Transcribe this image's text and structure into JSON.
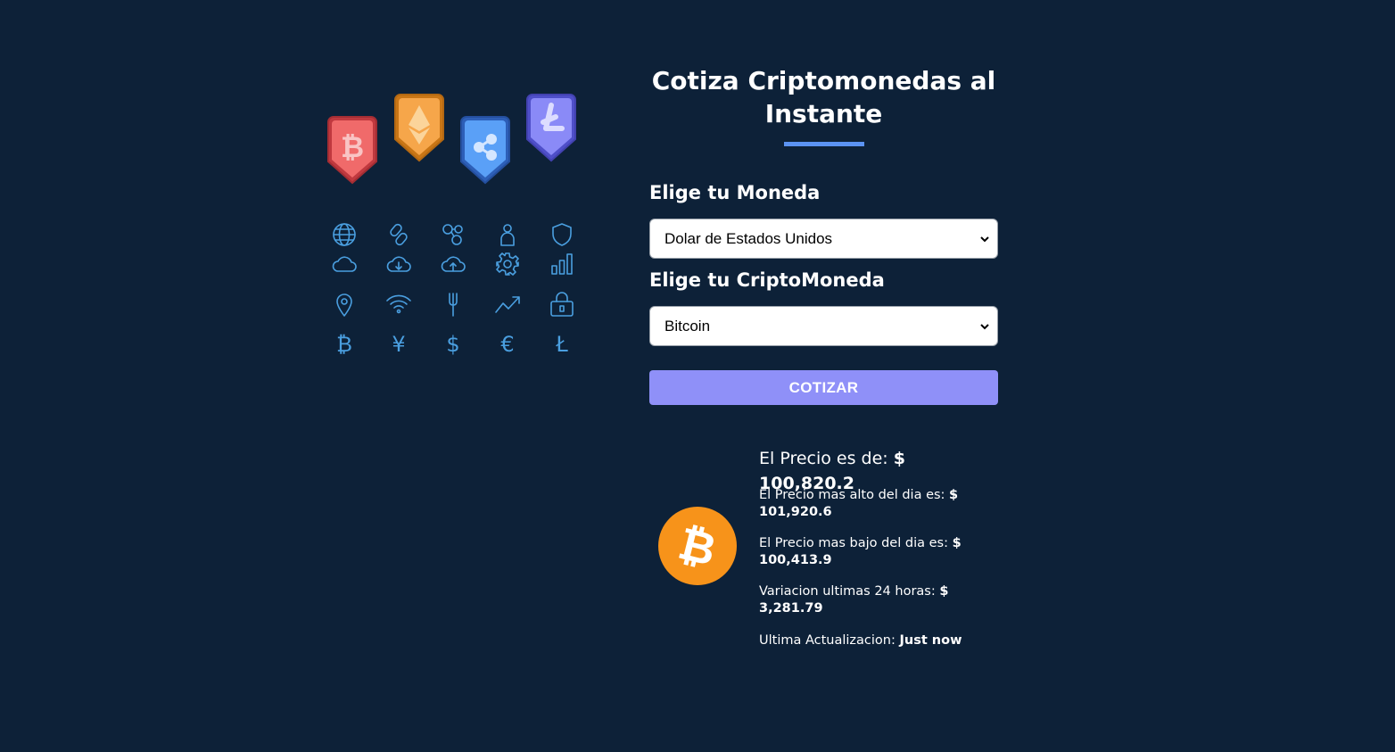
{
  "header": {
    "title": "Cotiza Criptomonedas al Instante"
  },
  "hero": {
    "badges": [
      {
        "icon": "bitcoin-badge-icon",
        "color": "#e45c5c"
      },
      {
        "icon": "ethereum-badge-icon",
        "color": "#f4a03b"
      },
      {
        "icon": "ripple-badge-icon",
        "color": "#4f92f2"
      },
      {
        "icon": "litecoin-badge-icon",
        "color": "#7e7ef0"
      }
    ],
    "icons": [
      "globe-icon",
      "link-icon",
      "network-icon",
      "user-icon",
      "shield-icon",
      "cloud-icon",
      "cloud-download-icon",
      "cloud-upload-icon",
      "gear-icon",
      "bar-chart-icon",
      "location-pin-icon",
      "wifi-icon",
      "fork-icon",
      "trend-up-icon",
      "lock-icon",
      "bitcoin-icon",
      "yen-icon",
      "dollar-icon",
      "euro-icon",
      "litecoin-icon"
    ],
    "icon_color": "#4a9fe0"
  },
  "form": {
    "currency_label": "Elige tu Moneda",
    "currency_selected": "Dolar de Estados Unidos",
    "crypto_label": "Elige tu CriptoMoneda",
    "crypto_selected": "Bitcoin",
    "submit_label": "COTIZAR",
    "submit_color": "#8f90f8"
  },
  "result": {
    "coin_icon": "bitcoin-logo-icon",
    "coin_color": "#f7931a",
    "price_label": "El Precio es de: ",
    "price_value": "$ 100,820.2",
    "high_label": "El Precio mas alto del dia es: ",
    "high_value": "$ 101,920.6",
    "low_label": "El Precio mas bajo del dia es: ",
    "low_value": "$ 100,413.9",
    "change_label": "Variacion ultimas 24 horas: ",
    "change_value": "$ 3,281.79",
    "updated_label": "Ultima Actualizacion: ",
    "updated_value": "Just now"
  },
  "colors": {
    "background": "#0d2138",
    "accent": "#5b93f2"
  }
}
